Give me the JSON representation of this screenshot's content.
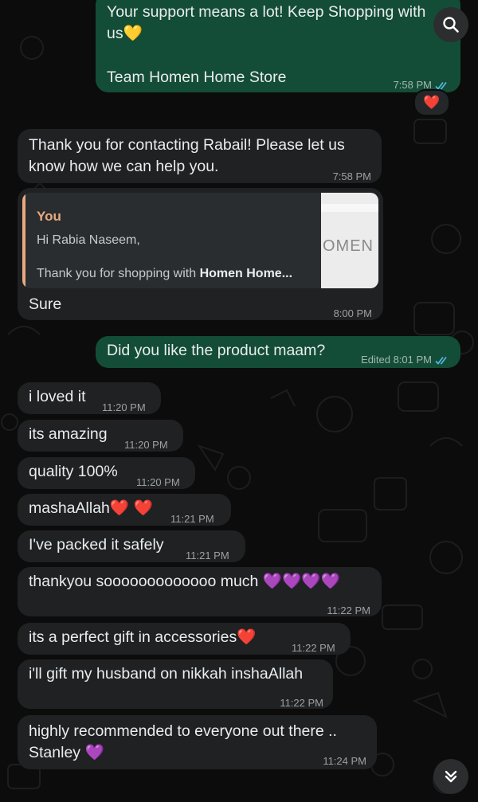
{
  "messages": {
    "m1": {
      "line1": "Your support means a lot! Keep Shopping with",
      "line2": "us",
      "emoji": "💛",
      "line3": "Team Homen Home Store",
      "time": "7:58 PM",
      "reaction": "❤️"
    },
    "m2": {
      "line1": "Thank you for contacting Rabail! Please let us",
      "line2": "know how we can help you.",
      "time": "7:58 PM"
    },
    "m3": {
      "quote_author": "You",
      "quote_line1": "Hi Rabia Naseem,",
      "quote_line2_prefix": "Thank you for shopping with ",
      "quote_line2_bold": "Homen Home...",
      "thumb_text": "OMEN",
      "text": "Sure",
      "time": "8:00 PM"
    },
    "m4": {
      "text": "Did you like the product maam?",
      "time": "Edited 8:01 PM"
    },
    "m5": {
      "text": "i loved it",
      "time": "11:20 PM"
    },
    "m6": {
      "text": "its amazing",
      "time": "11:20 PM"
    },
    "m7": {
      "text": "quality 100%",
      "time": "11:20 PM"
    },
    "m8": {
      "text": "mashaAllah",
      "emoji": "❤️ ❤️",
      "time": "11:21 PM"
    },
    "m9": {
      "text": "I've packed it safely",
      "time": "11:21 PM"
    },
    "m10": {
      "text": "thankyou sooooooooooooo much",
      "emoji": "💜💜💜💜",
      "time": "11:22 PM"
    },
    "m11": {
      "text": "its a perfect gift in accessories",
      "emoji": "❤️",
      "time": "11:22 PM"
    },
    "m12": {
      "text": "i'll gift my husband on nikkah inshaAllah",
      "time": "11:22 PM"
    },
    "m13": {
      "line1": "highly recommended to everyone out there ..",
      "line2": "Stanley",
      "emoji": "💜",
      "time": "11:24 PM"
    }
  },
  "colors": {
    "background": "#0b0c0b",
    "incoming_bubble": "#1f2123",
    "outgoing_bubble": "#144d37",
    "read_ticks": "#53bdeb",
    "quote_bar": "#e8a880"
  },
  "icons": {
    "search": "search-icon",
    "scroll_down": "double-chevron-down-icon",
    "read_receipt": "double-check-icon"
  }
}
